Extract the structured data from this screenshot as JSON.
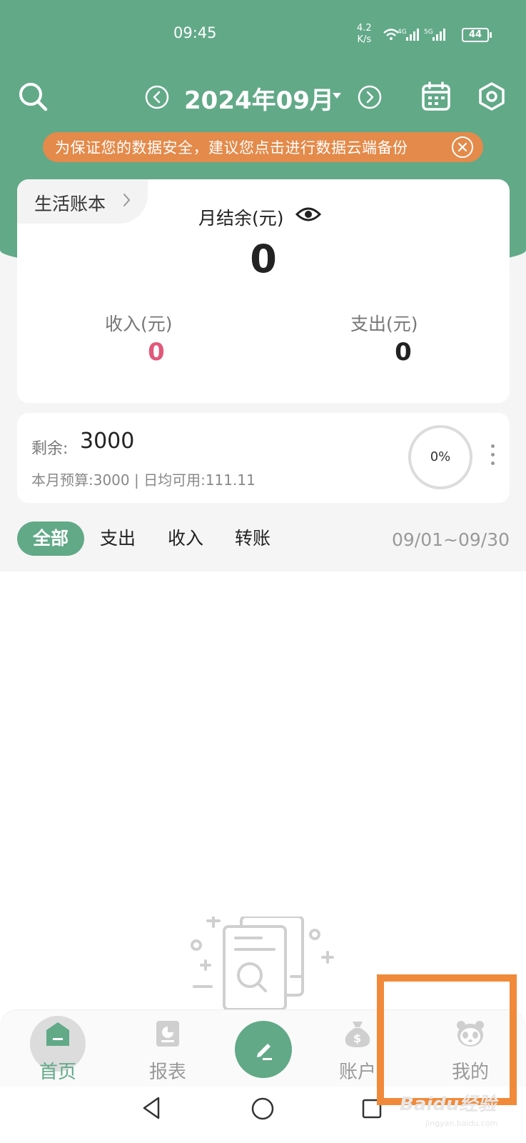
{
  "status_bar": {
    "time": "09:45",
    "speed_top": "4.2",
    "speed_bottom": "K/s",
    "battery": "44",
    "network_4g": "4G",
    "network_5g": "5G"
  },
  "header": {
    "month_title": "2024年09月",
    "search_icon": "search-icon",
    "prev_icon": "chevron-left-circle-icon",
    "next_icon": "chevron-right-circle-icon",
    "calendar_icon": "calendar-icon",
    "settings_icon": "hexagon-gear-icon",
    "color": "#62a988"
  },
  "banner": {
    "text": "为保证您的数据安全，建议您点击进行数据云端备份",
    "color": "#e48a4a"
  },
  "summary": {
    "book_label": "生活账本",
    "balance_label": "月结余(元)",
    "balance_value": "0",
    "income_label": "收入(元)",
    "income_value": "0",
    "income_color": "#e0587a",
    "expense_label": "支出(元)",
    "expense_value": "0"
  },
  "budget": {
    "remain_label": "剩余:",
    "remain_value": "3000",
    "detail": "本月预算:3000 | 日均可用:111.11",
    "progress_text": "0%",
    "progress_fraction": 0
  },
  "filter_tabs": [
    {
      "label": "全部",
      "active": true
    },
    {
      "label": "支出",
      "active": false
    },
    {
      "label": "收入",
      "active": false
    },
    {
      "label": "转账",
      "active": false
    }
  ],
  "date_range": "09/01~09/30",
  "bottom_nav": [
    {
      "label": "首页",
      "icon": "home-icon",
      "active": true
    },
    {
      "label": "报表",
      "icon": "report-icon",
      "active": false
    },
    {
      "label": "",
      "icon": "pencil-icon",
      "active": false
    },
    {
      "label": "账户",
      "icon": "money-bag-icon",
      "active": false
    },
    {
      "label": "我的",
      "icon": "panda-icon",
      "active": false
    }
  ],
  "watermark": {
    "brand": "Baidu经验",
    "sub": "jingyan.baidu.com"
  }
}
